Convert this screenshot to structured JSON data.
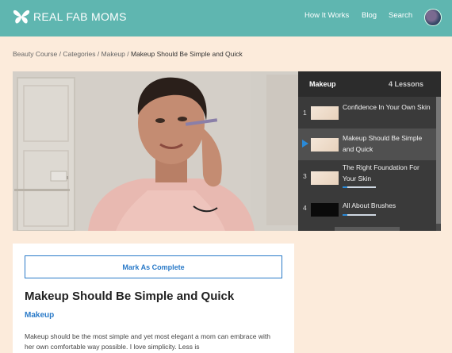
{
  "header": {
    "logo_text": "REAL FAB MOMS",
    "nav": [
      "How It Works",
      "Blog",
      "Search"
    ],
    "brand_color": "#5fb6b0"
  },
  "breadcrumb": {
    "items": [
      "Beauty Course",
      "Categories",
      "Makeup"
    ],
    "separator": "/",
    "current": "Makeup Should Be Simple and Quick"
  },
  "lessons_panel": {
    "title": "Makeup",
    "count": "4 Lessons",
    "items": [
      {
        "num": "1",
        "title": "Confidence In Your Own Skin",
        "active": false,
        "progress": 0
      },
      {
        "num": "",
        "title": "Makeup Should Be Simple and Quick",
        "active": true,
        "progress": 0
      },
      {
        "num": "3",
        "title": "The Right Foundation For Your Skin",
        "active": false,
        "progress": 0.15
      },
      {
        "num": "4",
        "title": "All About Brushes",
        "active": false,
        "progress": 0.15
      }
    ]
  },
  "lesson": {
    "mark_complete_label": "Mark As Complete",
    "title": "Makeup Should Be Simple and Quick",
    "category": "Makeup",
    "description": "Makeup should be the most simple and yet most elegant a mom can embrace with her own comfortable way possible. I love simplicity. Less is"
  }
}
